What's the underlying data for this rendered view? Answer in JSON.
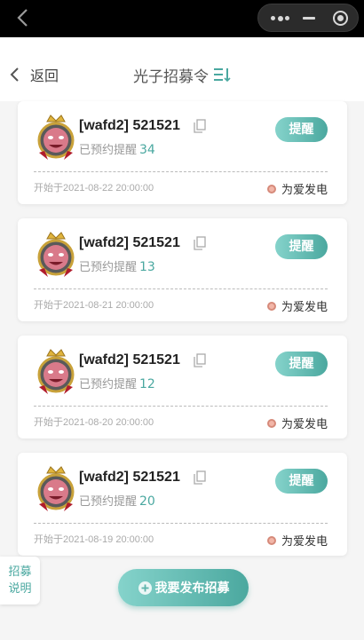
{
  "nav": {
    "back_label": "返回",
    "title": "光子招募令"
  },
  "cards": [
    {
      "title": "[wafd2] 521521",
      "reserve_label": "已预约提醒",
      "reserve_count": "34",
      "remind_label": "提醒",
      "start_time": "开始于2021-08-22 20:00:00",
      "publisher": "为爱发电"
    },
    {
      "title": "[wafd2] 521521",
      "reserve_label": "已预约提醒",
      "reserve_count": "13",
      "remind_label": "提醒",
      "start_time": "开始于2021-08-21 20:00:00",
      "publisher": "为爱发电"
    },
    {
      "title": "[wafd2] 521521",
      "reserve_label": "已预约提醒",
      "reserve_count": "12",
      "remind_label": "提醒",
      "start_time": "开始于2021-08-20 20:00:00",
      "publisher": "为爱发电"
    },
    {
      "title": "[wafd2] 521521",
      "reserve_label": "已预约提醒",
      "reserve_count": "20",
      "remind_label": "提醒",
      "start_time": "开始于2021-08-19 20:00:00",
      "publisher": "为爱发电"
    }
  ],
  "side_tab": {
    "line1": "招募",
    "line2": "说明"
  },
  "publish_button": {
    "label": "我要发布招募"
  },
  "icons": {
    "top_back": "chevron-left-icon",
    "more": "more-dots-icon",
    "minimize": "minimize-icon",
    "close": "target-close-icon",
    "menu": "menu-list-icon",
    "copy": "copy-icon",
    "avatar": "crown-avatar-icon",
    "add": "plus-circle-icon"
  },
  "colors": {
    "accent": "#4aa8a0",
    "accent_light": "#85d3cb",
    "topbar": "#000000"
  }
}
